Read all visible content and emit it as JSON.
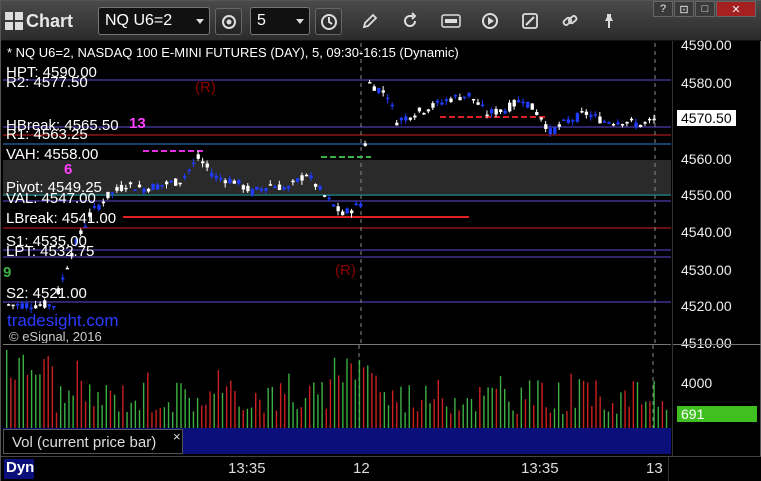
{
  "toolbar": {
    "title": "Chart",
    "symbol": "NQ U6=2",
    "interval": "5",
    "window_controls": [
      "?",
      "⊡",
      "□",
      "✕"
    ]
  },
  "chart": {
    "header": "* NQ U6=2, NASDAQ 100 E-MINI FUTURES (DAY), 5, 09:30-16:15 (Dynamic)",
    "copyright": "© eSignal, 2016",
    "watermark": "tradesight.com",
    "current_price": "4570.50",
    "levels": {
      "hpt": "HPT: 4590.00",
      "r2": "R2: 4577.50",
      "hbreak": "HBreak: 4565.50",
      "r1": "R1: 4563.25",
      "vah": "VAH: 4558.00",
      "pivot": "Pivot: 4549.25",
      "val": "VAL: 4547.00",
      "lbreak": "LBreak: 4541.00",
      "s1": "S1: 4535.00",
      "lpt": "LPT: 4532.75",
      "s2": "S2: 4521.00"
    },
    "markers": {
      "r_left": "(R)",
      "r_mid": "(R)",
      "n13": "13",
      "n6": "6",
      "n9": "9"
    },
    "accent": {
      "up": "#ffffff",
      "down": "#1f3cff",
      "vol_up": "#3cb043",
      "vol_down": "#cc2020"
    }
  },
  "price_axis": {
    "ticks": [
      "4590.00",
      "4580.00",
      "4570.00",
      "4560.00",
      "4550.00",
      "4540.00",
      "4530.00",
      "4520.00",
      "4510.00"
    ]
  },
  "volume": {
    "label": "Vol (current price bar)",
    "close_glyph": "×",
    "axis_tick": "4000",
    "current_value": "691"
  },
  "time_axis": {
    "brand": "Dyn",
    "labels": [
      "13:35",
      "12",
      "13:35",
      "13"
    ]
  },
  "chart_data": {
    "type": "candlestick",
    "title": "* NQ U6=2, NASDAQ 100 E-MINI FUTURES (DAY), 5, 09:30-16:15 (Dynamic)",
    "ylim": [
      4510,
      4590
    ],
    "last": 4570.5,
    "horizontal_levels": [
      4590.0,
      4577.5,
      4565.5,
      4563.25,
      4558.0,
      4549.25,
      4547.0,
      4541.0,
      4535.0,
      4532.75,
      4521.0
    ],
    "x_labels": [
      "13:35",
      "12",
      "13:35",
      "13"
    ]
  }
}
